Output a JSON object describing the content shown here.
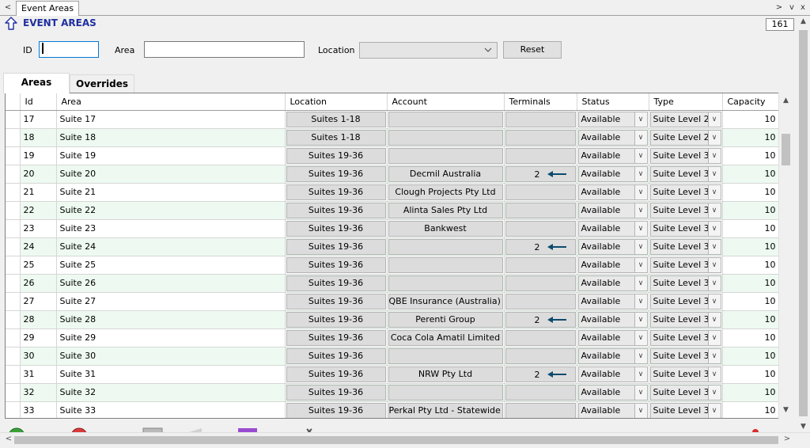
{
  "window": {
    "tab_title": "Event Areas",
    "nav_left": "<",
    "ctrl_chevron": ">",
    "ctrl_menu": "v",
    "ctrl_close": "x"
  },
  "header": {
    "title": "EVENT AREAS",
    "record_count": "161"
  },
  "filters": {
    "id_label": "ID",
    "id_value": "",
    "area_label": "Area",
    "area_value": "",
    "location_label": "Location",
    "location_value": "",
    "reset_label": "Reset"
  },
  "tabs": [
    {
      "label": "Areas"
    },
    {
      "label": "Overrides"
    }
  ],
  "grid": {
    "columns": [
      "Id",
      "Area",
      "Location",
      "Account",
      "Terminals",
      "Status",
      "Type",
      "Capacity"
    ],
    "rows": [
      {
        "id": "17",
        "area": "Suite 17",
        "location": "Suites 1-18",
        "account": "",
        "terminals": "",
        "status": "Available",
        "type": "Suite Level 2",
        "capacity": "10"
      },
      {
        "id": "18",
        "area": "Suite 18",
        "location": "Suites 1-18",
        "account": "",
        "terminals": "",
        "status": "Available",
        "type": "Suite Level 2",
        "capacity": "10"
      },
      {
        "id": "19",
        "area": "Suite 19",
        "location": "Suites 19-36",
        "account": "",
        "terminals": "",
        "status": "Available",
        "type": "Suite Level 3",
        "capacity": "10"
      },
      {
        "id": "20",
        "area": "Suite 20",
        "location": "Suites 19-36",
        "account": "Decmil Australia",
        "terminals": "2",
        "status": "Available",
        "type": "Suite Level 3",
        "capacity": "10"
      },
      {
        "id": "21",
        "area": "Suite 21",
        "location": "Suites 19-36",
        "account": "Clough Projects Pty Ltd",
        "terminals": "",
        "status": "Available",
        "type": "Suite Level 3",
        "capacity": "10"
      },
      {
        "id": "22",
        "area": "Suite 22",
        "location": "Suites 19-36",
        "account": "Alinta Sales Pty Ltd",
        "terminals": "",
        "status": "Available",
        "type": "Suite Level 3",
        "capacity": "10"
      },
      {
        "id": "23",
        "area": "Suite 23",
        "location": "Suites 19-36",
        "account": "Bankwest",
        "terminals": "",
        "status": "Available",
        "type": "Suite Level 3",
        "capacity": "10"
      },
      {
        "id": "24",
        "area": "Suite 24",
        "location": "Suites 19-36",
        "account": "",
        "terminals": "2",
        "status": "Available",
        "type": "Suite Level 3",
        "capacity": "10"
      },
      {
        "id": "25",
        "area": "Suite 25",
        "location": "Suites 19-36",
        "account": "",
        "terminals": "",
        "status": "Available",
        "type": "Suite Level 3",
        "capacity": "10"
      },
      {
        "id": "26",
        "area": "Suite 26",
        "location": "Suites 19-36",
        "account": "",
        "terminals": "",
        "status": "Available",
        "type": "Suite Level 3",
        "capacity": "10"
      },
      {
        "id": "27",
        "area": "Suite 27",
        "location": "Suites 19-36",
        "account": "QBE Insurance (Australia) Ltd",
        "terminals": "",
        "status": "Available",
        "type": "Suite Level 3",
        "capacity": "10"
      },
      {
        "id": "28",
        "area": "Suite 28",
        "location": "Suites 19-36",
        "account": "Perenti Group",
        "terminals": "2",
        "status": "Available",
        "type": "Suite Level 3",
        "capacity": "10"
      },
      {
        "id": "29",
        "area": "Suite 29",
        "location": "Suites 19-36",
        "account": "Coca Cola Amatil Limited",
        "terminals": "",
        "status": "Available",
        "type": "Suite Level 3",
        "capacity": "10"
      },
      {
        "id": "30",
        "area": "Suite 30",
        "location": "Suites 19-36",
        "account": "",
        "terminals": "",
        "status": "Available",
        "type": "Suite Level 3",
        "capacity": "10"
      },
      {
        "id": "31",
        "area": "Suite 31",
        "location": "Suites 19-36",
        "account": "NRW Pty Ltd",
        "terminals": "2",
        "status": "Available",
        "type": "Suite Level 3",
        "capacity": "10"
      },
      {
        "id": "32",
        "area": "Suite 32",
        "location": "Suites 19-36",
        "account": "",
        "terminals": "",
        "status": "Available",
        "type": "Suite Level 3",
        "capacity": "10"
      },
      {
        "id": "33",
        "area": "Suite 33",
        "location": "Suites 19-36",
        "account": "Perkal Pty Ltd - Statewide Oil",
        "terminals": "",
        "status": "Available",
        "type": "Suite Level 3",
        "capacity": "10"
      }
    ]
  },
  "icons": {
    "up_arrow": "up-arrow-icon",
    "terminal_arrow": "arrow-left-icon",
    "toolbar": [
      "add-icon",
      "delete-icon",
      "save-icon",
      "back-icon",
      "edit-icon",
      "tools-icon",
      "alert-icon"
    ]
  },
  "colors": {
    "title": "#1f2f9f",
    "alt_row": "#eefaf1",
    "arrow": "#0d4a6e",
    "focus_border": "#0078d7"
  }
}
